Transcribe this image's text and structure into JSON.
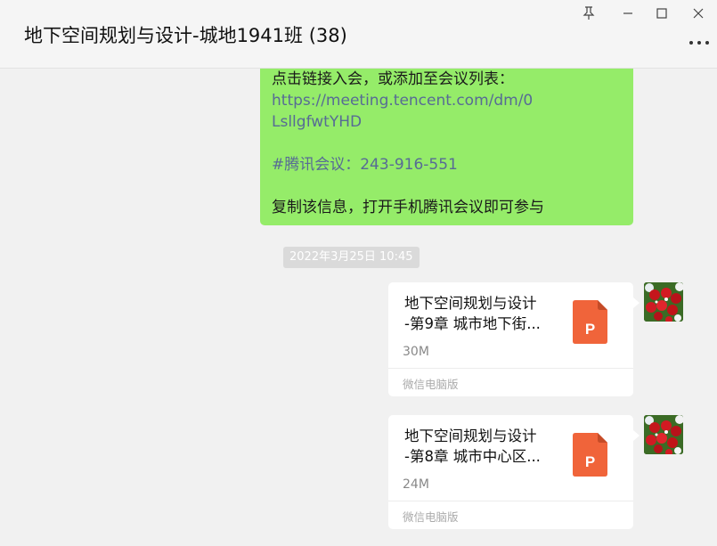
{
  "header": {
    "title": "地下空间规划与设计-城地1941班 (38)",
    "window": {
      "pin_icon": "pin-icon",
      "minimize_icon": "minimize-icon",
      "maximize_icon": "maximize-icon",
      "close_icon": "close-icon"
    },
    "more_icon": "more-icon"
  },
  "messages": {
    "meeting": {
      "line1": "点击链接入会，或添加至会议列表：",
      "link_line1": "https://meeting.tencent.com/dm/0",
      "link_line2": "LsllgfwtYHD",
      "meeting_id": "#腾讯会议：243-916-551",
      "instruction": "复制该信息，打开手机腾讯会议即可参与"
    },
    "timestamp": "2022年3月25日 10:45",
    "files": [
      {
        "name_line1": "地下空间规划与设计",
        "name_line2": "-第9章 城市地下街...",
        "size": "30M",
        "source": "微信电脑版",
        "icon": "ppt-file-icon",
        "icon_letter": "P"
      },
      {
        "name_line1": "地下空间规划与设计",
        "name_line2": "-第8章 城市中心区...",
        "size": "24M",
        "source": "微信电脑版",
        "icon": "ppt-file-icon",
        "icon_letter": "P"
      }
    ],
    "avatar_icon": "rose-bouquet-avatar"
  },
  "colors": {
    "bubble_green": "#95ec69",
    "link": "#576b95",
    "ppt_orange": "#f0643a",
    "background": "#f1f1f1"
  }
}
